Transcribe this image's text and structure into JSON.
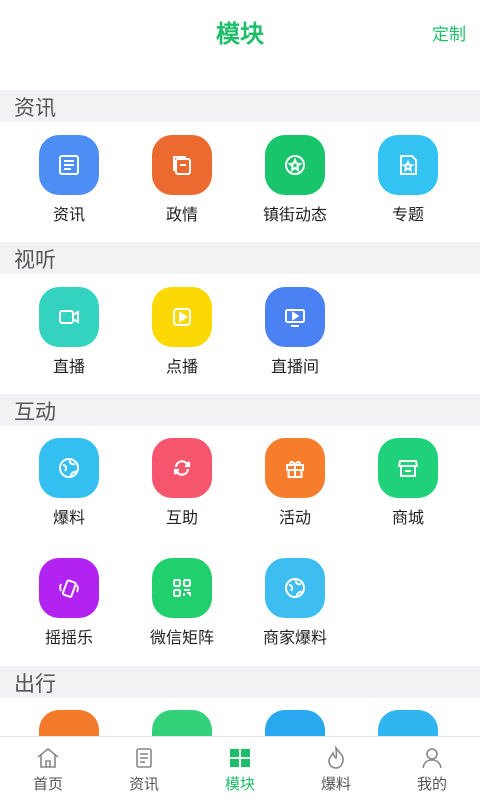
{
  "header": {
    "title": "模块",
    "custom": "定制"
  },
  "sections": {
    "s1": "资讯",
    "s2": "视听",
    "s3": "互动",
    "s4": "出行"
  },
  "items": {
    "news": "资讯",
    "politics": "政情",
    "town": "镇街动态",
    "topic": "专题",
    "live": "直播",
    "vod": "点播",
    "liveroom": "直播间",
    "tipoff": "爆料",
    "mutual": "互助",
    "activity": "活动",
    "mall": "商城",
    "shake": "摇摇乐",
    "wechat": "微信矩阵",
    "merchant": "商家爆料"
  },
  "colors": {
    "news": "#4d8ef5",
    "politics": "#ec6a2f",
    "town": "#19c56a",
    "topic": "#33c3f2",
    "live": "#34d3bf",
    "vod": "#fcd904",
    "liveroom": "#4b82f3",
    "tipoff": "#33bff0",
    "mutual": "#f5566d",
    "activity": "#f57d2c",
    "mall": "#1fd27a",
    "shake": "#b222f0",
    "wechat": "#21d06c",
    "merchant": "#3ebdf0",
    "travel1": "#f27a2a",
    "travel2": "#33d27a",
    "travel3": "#2aa8ef",
    "travel4": "#31b5f0",
    "accent": "#1fbf6a"
  },
  "tabs": {
    "home": "首页",
    "news": "资讯",
    "module": "模块",
    "tipoff": "爆料",
    "mine": "我的"
  }
}
